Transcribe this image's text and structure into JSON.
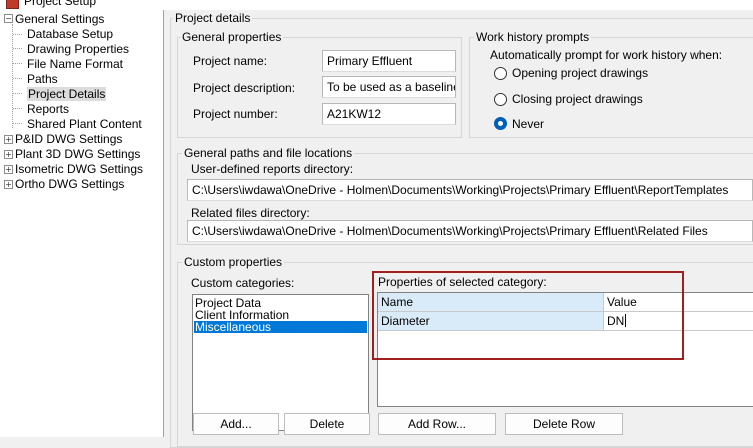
{
  "window": {
    "title": "Project Setup"
  },
  "tree": {
    "items": [
      {
        "label": "General Settings",
        "expanded": true
      },
      {
        "label": "Database Setup"
      },
      {
        "label": "Drawing Properties"
      },
      {
        "label": "File Name Format"
      },
      {
        "label": "Paths"
      },
      {
        "label": "Project Details",
        "selected": true
      },
      {
        "label": "Reports"
      },
      {
        "label": "Shared Plant Content"
      },
      {
        "label": "P&ID DWG Settings",
        "expanded": false
      },
      {
        "label": "Plant 3D DWG Settings",
        "expanded": false
      },
      {
        "label": "Isometric DWG Settings",
        "expanded": false
      },
      {
        "label": "Ortho DWG Settings",
        "expanded": false
      }
    ],
    "expand_glyph": "+",
    "collapse_glyph": "−"
  },
  "details": {
    "section_title": "Project details",
    "general_properties": {
      "title": "General properties",
      "name_label": "Project name:",
      "name_value": "Primary Effluent",
      "description_label": "Project description:",
      "description_value": "To be used as a baseline",
      "number_label": "Project number:",
      "number_value": "A21KW12"
    },
    "work_history": {
      "title": "Work history prompts",
      "prompt_label": "Automatically prompt for work history when:",
      "options": [
        {
          "label": "Opening project drawings",
          "checked": false
        },
        {
          "label": "Closing project drawings",
          "checked": false
        },
        {
          "label": "Never",
          "checked": true
        }
      ]
    },
    "paths": {
      "title": "General paths and file locations",
      "reports_label": "User-defined reports directory:",
      "reports_value": "C:\\Users\\iwdawa\\OneDrive - Holmen\\Documents\\Working\\Projects\\Primary Effluent\\ReportTemplates",
      "related_label": "Related files directory:",
      "related_value": "C:\\Users\\iwdawa\\OneDrive - Holmen\\Documents\\Working\\Projects\\Primary Effluent\\Related Files"
    },
    "custom": {
      "title": "Custom properties",
      "categories_label": "Custom categories:",
      "categories": [
        {
          "label": "Project Data",
          "selected": false
        },
        {
          "label": "Client Information",
          "selected": false
        },
        {
          "label": "Miscellaneous",
          "selected": true
        }
      ],
      "properties_label": "Properties of selected category:",
      "grid_headers": {
        "name": "Name",
        "value": "Value"
      },
      "grid_rows": [
        {
          "name": "Diameter",
          "value": "DN"
        }
      ],
      "buttons": {
        "add": "Add...",
        "delete": "Delete",
        "add_row": "Add Row...",
        "delete_row": "Delete Row"
      }
    }
  },
  "colors": {
    "selection": "#0078d7",
    "grid_header": "#d9ebf9",
    "highlight": "#a02020",
    "radio_checked": "#005fb8"
  }
}
